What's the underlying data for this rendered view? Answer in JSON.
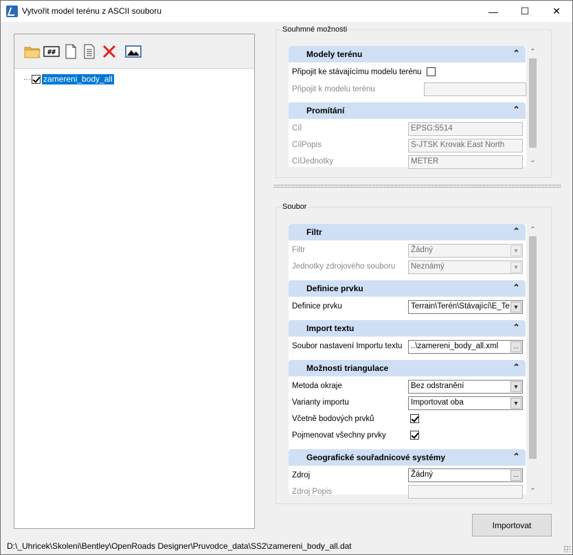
{
  "window": {
    "title": "Vytvořit model terénu z ASCII souboru",
    "minimize": "—",
    "maximize": "☐",
    "close": "✕"
  },
  "left": {
    "toolbar": {
      "icons": [
        "open-folder-icon",
        "grid-icon",
        "new-document-icon",
        "text-document-icon",
        "delete-icon",
        "image-preview-icon"
      ]
    },
    "tree": {
      "items": [
        {
          "label": "zamereni_body_all",
          "checked": true
        }
      ]
    }
  },
  "summary": {
    "legend": "Souhmné možnosti",
    "models": {
      "header": "Modely terénu",
      "attach_label": "Připojit ke stávajícímu modelu terénu",
      "attach_checked": false,
      "attach_to_label": "Připojit k modelu terénu",
      "attach_to_value": ""
    },
    "projection": {
      "header": "Promítání",
      "cil_label": "Cíl",
      "cil_value": "EPSG:5514",
      "cilpopis_label": "CílPopis",
      "cilpopis_value": "S-JTSK Krovak East North",
      "ciljednotky_label": "CílJednotky",
      "ciljednotky_value": "METER"
    }
  },
  "file": {
    "legend": "Soubor",
    "filter": {
      "header": "Filtr",
      "filtr_label": "Filtr",
      "filtr_value": "Žádný",
      "units_label": "Jednotky zdrojového souboru",
      "units_value": "Neznámý"
    },
    "feature": {
      "header": "Definice prvku",
      "def_label": "Definice prvku",
      "def_value": "Terrain\\Terén\\Stávající\\E_Te"
    },
    "import_text": {
      "header": "Import textu",
      "settings_label": "Soubor nastavení Importu textu",
      "settings_value": "..\\zamereni_body_all.xml"
    },
    "triangulation": {
      "header": "Možnosti triangulace",
      "edge_label": "Metoda okraje",
      "edge_value": "Bez odstranění",
      "variants_label": "Varianty importu",
      "variants_value": "Importovat oba",
      "points_label": "Včetně bodových prvků",
      "points_checked": true,
      "name_all_label": "Pojmenovat všechny prvky",
      "name_all_checked": true
    },
    "gcs": {
      "header": "Geografické souřadnicové systémy",
      "source_label": "Zdroj",
      "source_value": "Žádný",
      "source_desc_label": "Zdroj Popis",
      "source_desc_value": ""
    }
  },
  "actions": {
    "import_label": "Importovat"
  },
  "status": {
    "path": "D:\\_Uhricek\\Skoleni\\Bentley\\OpenRoads Designer\\Pruvodce_data\\SS2\\zamereni_body_all.dat"
  }
}
